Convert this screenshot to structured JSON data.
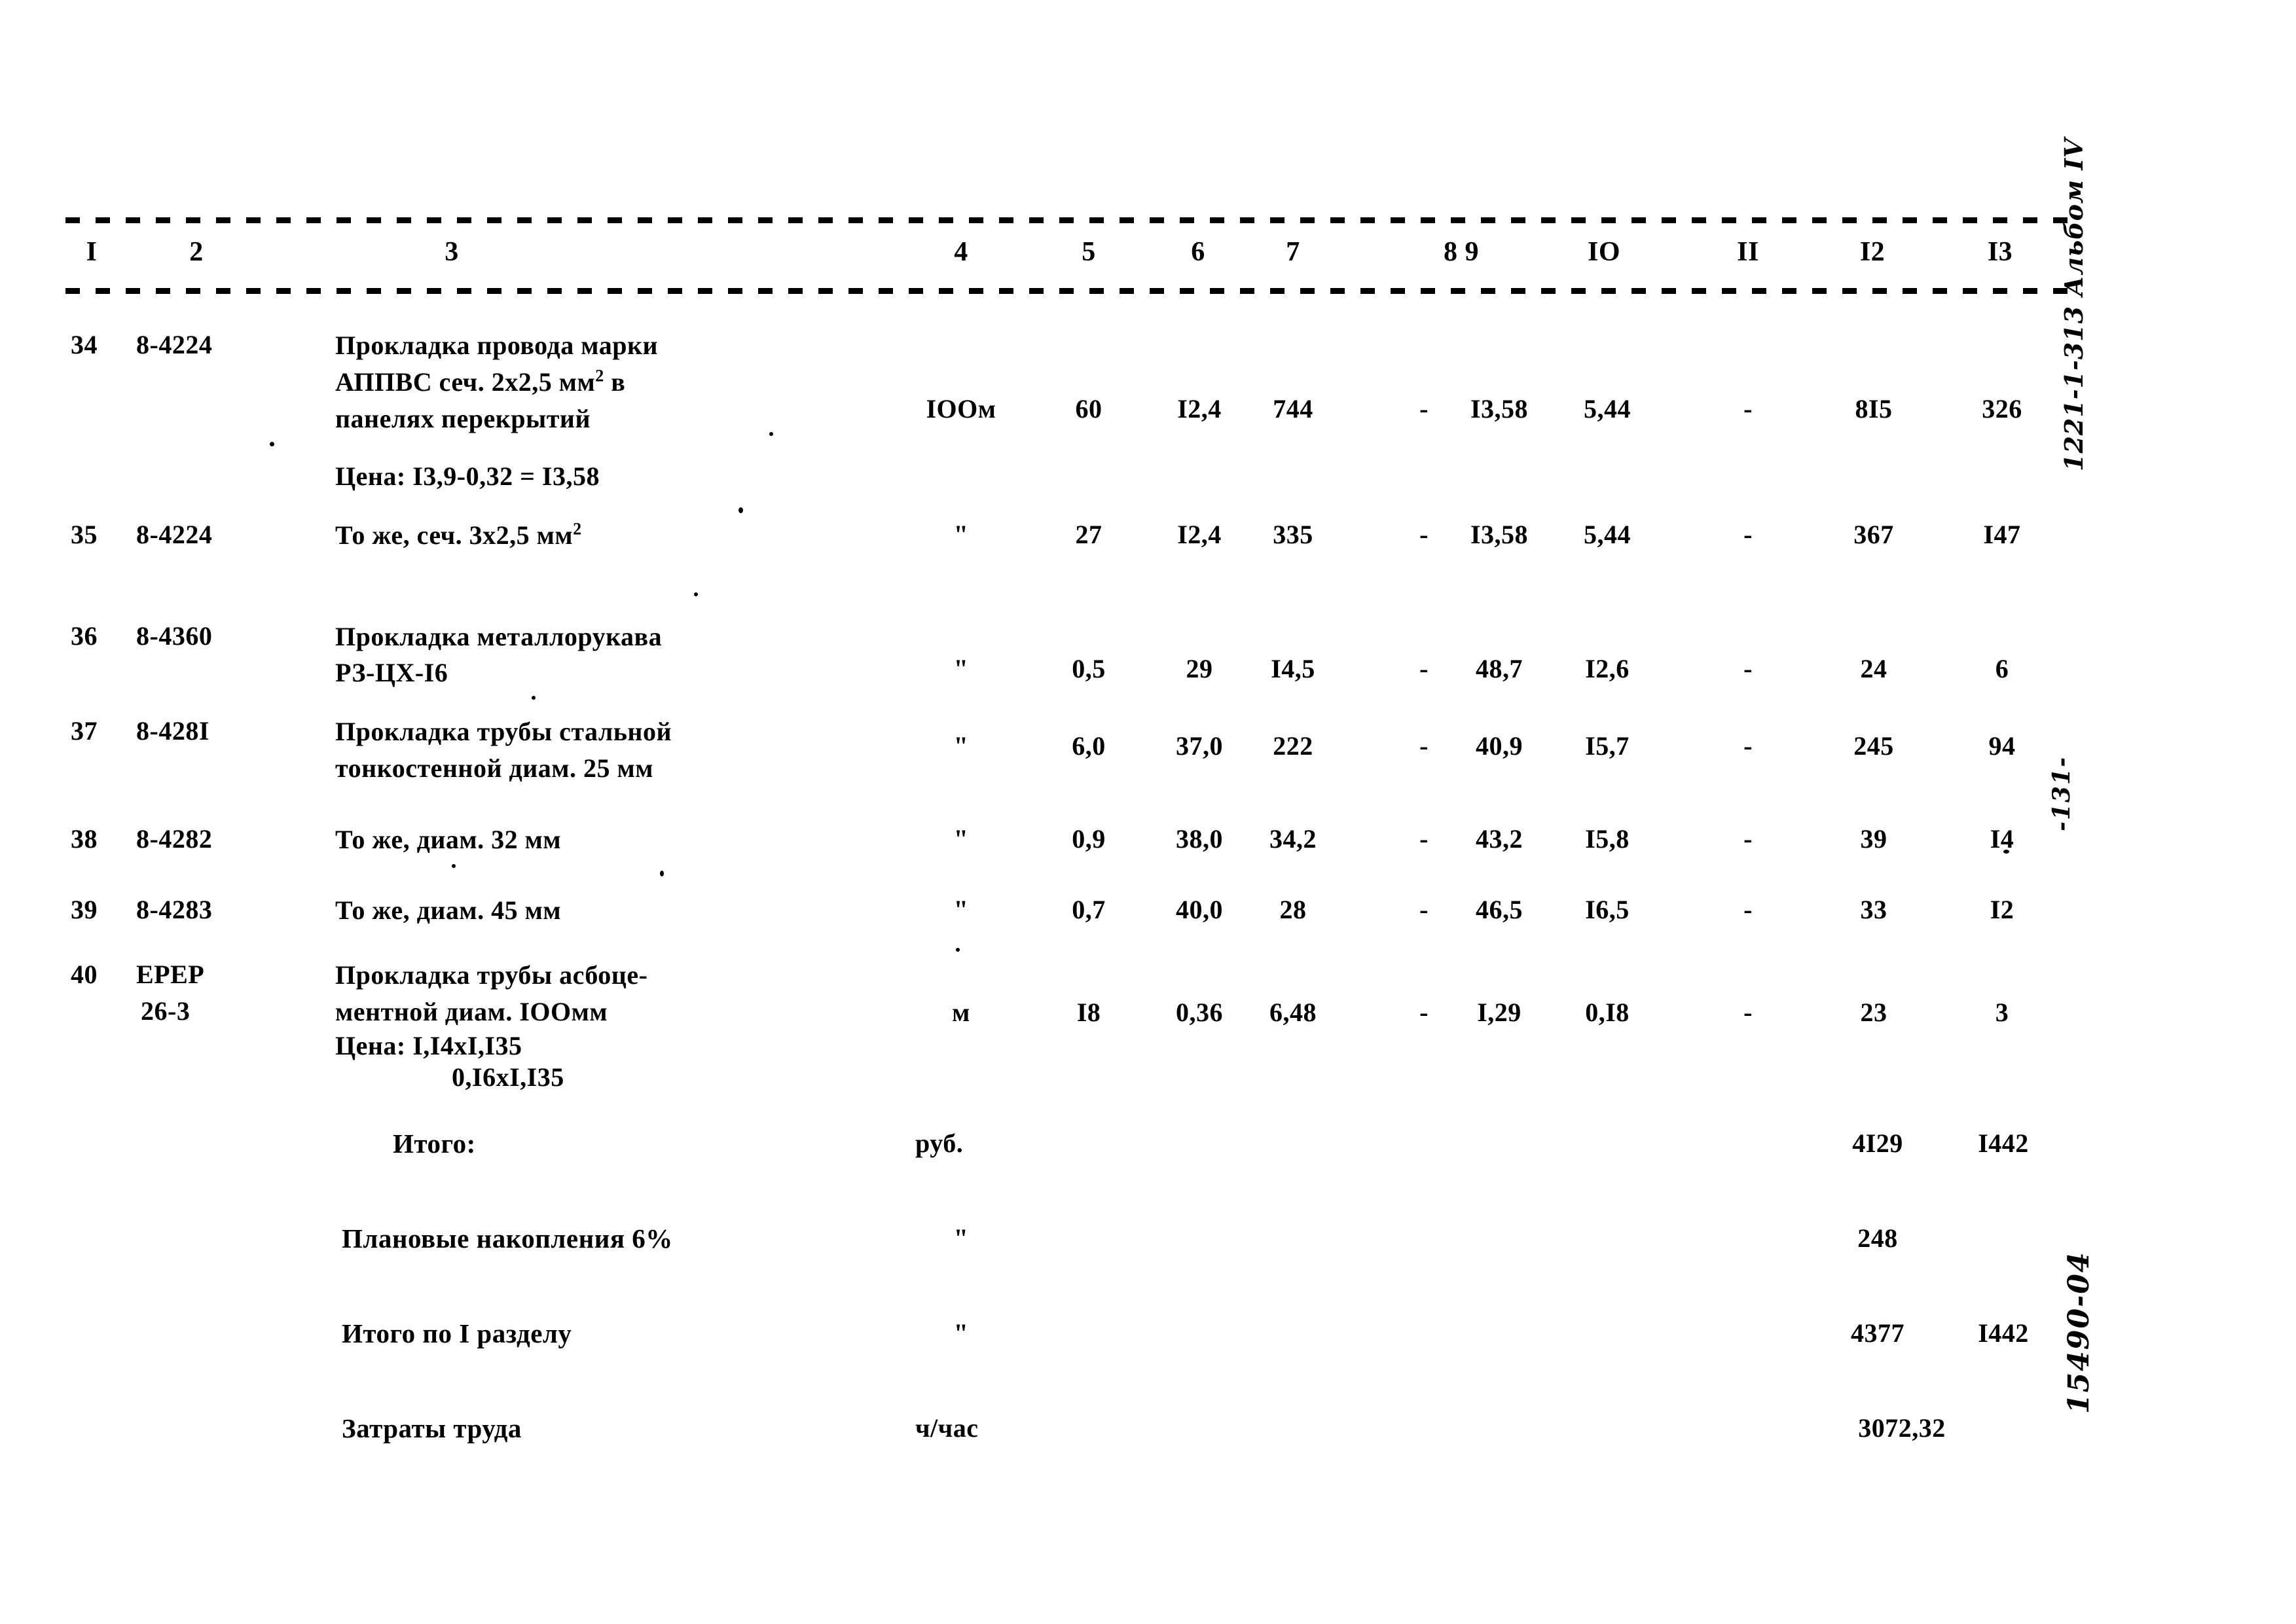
{
  "document": {
    "type": "construction-estimate-table",
    "language": "ru"
  },
  "table": {
    "column_headers": [
      "I",
      "2",
      "3",
      "4",
      "5",
      "6",
      "7",
      "8 9",
      "IO",
      "II",
      "I2",
      "I3"
    ],
    "rows": [
      {
        "num": "34",
        "code": "8-4224",
        "desc_lines": [
          "Прокладка провода марки",
          "АППВС сеч. 2х2,5 мм",
          "панелях перекрытий"
        ],
        "desc_sup": "2",
        "desc_tail": " в",
        "note": "Цена: I3,9-0,32 = I3,58",
        "unit": "IOOм",
        "qty": "60",
        "c6": "I2,4",
        "c7": "744",
        "c8": "-",
        "c9": "I3,58",
        "c10": "5,44",
        "c11": "-",
        "c12": "8I5",
        "c13": "326"
      },
      {
        "num": "35",
        "code": "8-4224",
        "desc_lines": [
          "То же, сеч. 3х2,5 мм"
        ],
        "desc_sup": "2",
        "desc_tail": "",
        "note": "",
        "unit": "\"",
        "qty": "27",
        "c6": "I2,4",
        "c7": "335",
        "c8": "-",
        "c9": "I3,58",
        "c10": "5,44",
        "c11": "-",
        "c12": "367",
        "c13": "I47"
      },
      {
        "num": "36",
        "code": "8-4360",
        "desc_lines": [
          "Прокладка металлорукава",
          "РЗ-ЦХ-I6"
        ],
        "desc_sup": "",
        "desc_tail": "",
        "note": "",
        "unit": "\"",
        "qty": "0,5",
        "c6": "29",
        "c7": "I4,5",
        "c8": "-",
        "c9": "48,7",
        "c10": "I2,6",
        "c11": "-",
        "c12": "24",
        "c13": "6"
      },
      {
        "num": "37",
        "code": "8-428I",
        "desc_lines": [
          "Прокладка трубы стальной",
          "тонкостенной диам. 25 мм"
        ],
        "desc_sup": "",
        "desc_tail": "",
        "note": "",
        "unit": "\"",
        "qty": "6,0",
        "c6": "37,0",
        "c7": "222",
        "c8": "-",
        "c9": "40,9",
        "c10": "I5,7",
        "c11": "-",
        "c12": "245",
        "c13": "94"
      },
      {
        "num": "38",
        "code": "8-4282",
        "desc_lines": [
          "То же, диам. 32 мм"
        ],
        "desc_sup": "",
        "desc_tail": "",
        "note": "",
        "unit": "\"",
        "qty": "0,9",
        "c6": "38,0",
        "c7": "34,2",
        "c8": "-",
        "c9": "43,2",
        "c10": "I5,8",
        "c11": "-",
        "c12": "39",
        "c13": "I4"
      },
      {
        "num": "39",
        "code": "8-4283",
        "desc_lines": [
          "То же, диам. 45 мм"
        ],
        "desc_sup": "",
        "desc_tail": "",
        "note": "",
        "unit": "\"",
        "qty": "0,7",
        "c6": "40,0",
        "c7": "28",
        "c8": "-",
        "c9": "46,5",
        "c10": "I6,5",
        "c11": "-",
        "c12": "33",
        "c13": "I2"
      },
      {
        "num": "40",
        "code": "ЕРЕР",
        "code2": "26-3",
        "desc_lines": [
          "Прокладка трубы асбоце-",
          "ментной диам. IOOмм"
        ],
        "desc_sup": "",
        "desc_tail": "",
        "note": "Цена: I,I4хI,I35",
        "note2": "0,I6хI,I35",
        "unit": "м",
        "qty": "I8",
        "c6": "0,36",
        "c7": "6,48",
        "c8": "-",
        "c9": "I,29",
        "c10": "0,I8",
        "c11": "-",
        "c12": "23",
        "c13": "3"
      }
    ],
    "summary": [
      {
        "label": "Итого:",
        "unit": "руб.",
        "c12": "4I29",
        "c13": "I442"
      },
      {
        "label": "Плановые накопления 6%",
        "unit": "\"",
        "c12": "248",
        "c13": ""
      },
      {
        "label": "Итого по I разделу",
        "unit": "\"",
        "c12": "4377",
        "c13": "I442"
      },
      {
        "label": "Затраты труда",
        "unit": "ч/час",
        "c12": "3072,32",
        "c13": ""
      }
    ]
  },
  "marginalia": {
    "top_right": "1221-1-313 Альбом IV",
    "page_number": "-131-",
    "bottom_right": "15490-04"
  }
}
